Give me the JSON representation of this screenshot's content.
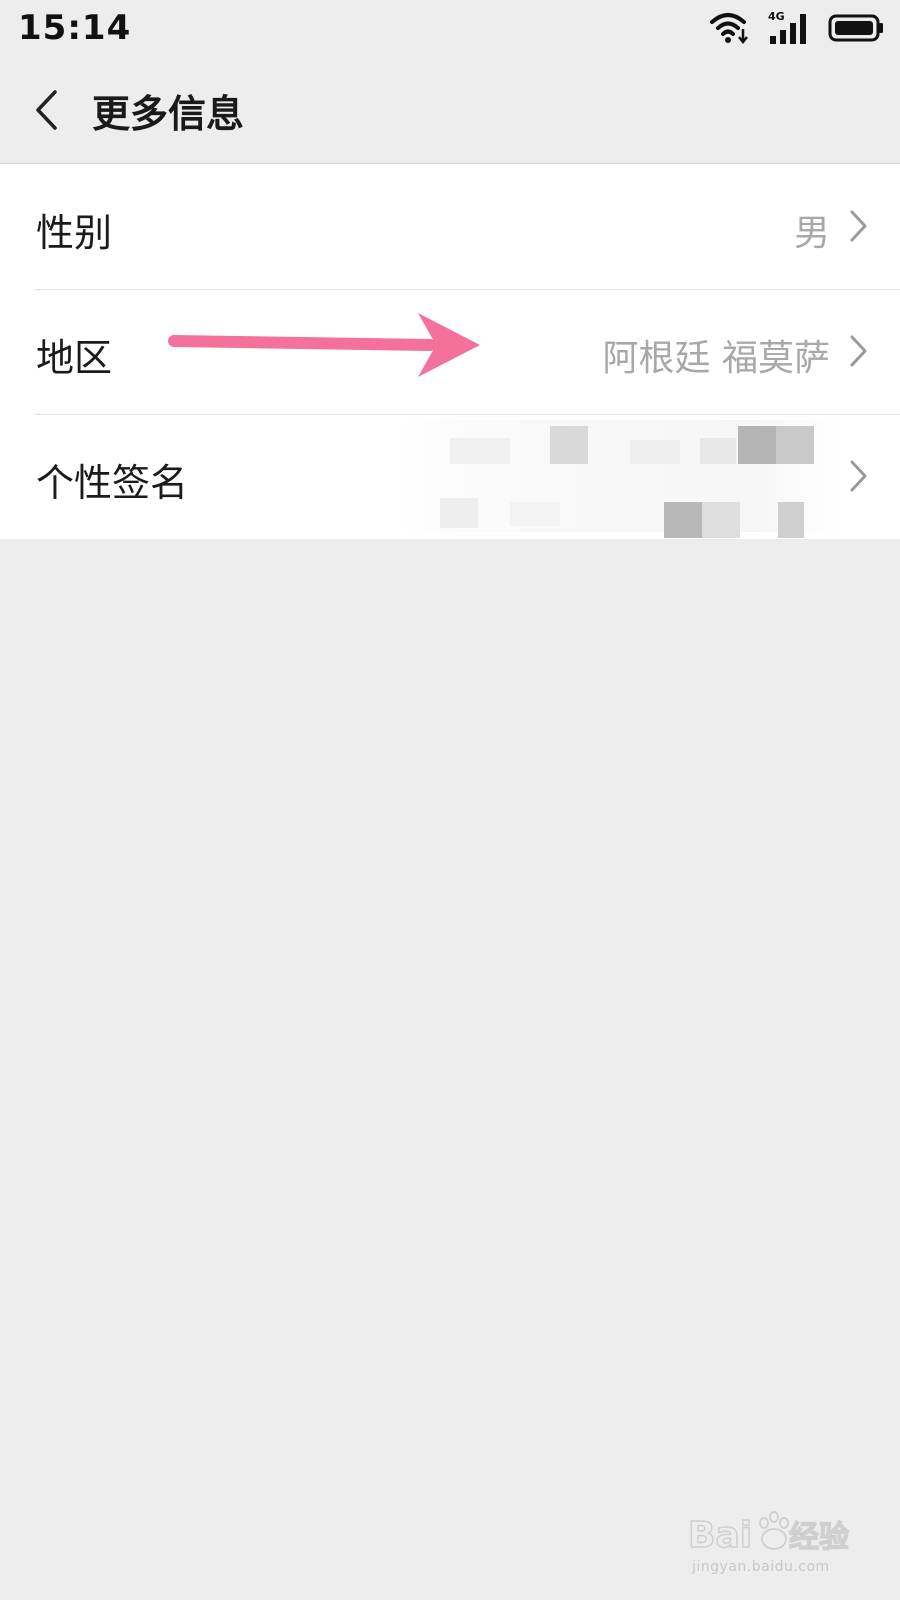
{
  "status_bar": {
    "time": "15:14",
    "network_label": "4G",
    "icons": [
      "wifi-icon",
      "cellular-signal-icon",
      "battery-icon"
    ]
  },
  "nav": {
    "title": "更多信息",
    "back_icon": "chevron-left-icon"
  },
  "rows": [
    {
      "label": "性别",
      "value": "男",
      "chevron": "chevron-right-icon"
    },
    {
      "label": "地区",
      "value": "阿根廷 福莫萨",
      "chevron": "chevron-right-icon"
    },
    {
      "label": "个性签名",
      "value": "",
      "chevron": "chevron-right-icon"
    }
  ],
  "annotation": {
    "arrow_color": "#f47199"
  },
  "watermark": {
    "brand": "Baidu经验",
    "url": "jingyan.baidu.com"
  },
  "colors": {
    "background": "#ededed",
    "list_background": "#ffffff",
    "value_text": "#a8a8a8",
    "label_text": "#1b1b1b"
  }
}
